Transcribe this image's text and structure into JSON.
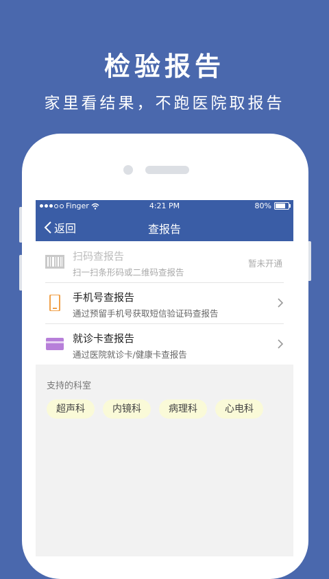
{
  "hero": {
    "title": "检验报告",
    "subtitle": "家里看结果，不跑医院取报告"
  },
  "status_bar": {
    "carrier": "Finger",
    "time": "4:21 PM",
    "battery": "80%"
  },
  "nav": {
    "back_label": "返回",
    "title": "查报告"
  },
  "options": [
    {
      "title": "扫码查报告",
      "desc": "扫一扫条形码或二维码查报告",
      "status": "暂未开通",
      "icon": "barcode-icon"
    },
    {
      "title": "手机号查报告",
      "desc": "通过预留手机号获取短信验证码查报告",
      "icon": "phone-icon"
    },
    {
      "title": "就诊卡查报告",
      "desc": "通过医院就诊卡/健康卡查报告",
      "icon": "card-icon"
    }
  ],
  "departments": {
    "label": "支持的科室",
    "items": [
      "超声科",
      "内镜科",
      "病理科",
      "心电科"
    ]
  },
  "colors": {
    "background": "#4a68ad",
    "navbar": "#3a5da6",
    "phone_icon": "#f0a14a",
    "card_icon": "#b77fd9",
    "tag_bg": "#fafad8"
  }
}
